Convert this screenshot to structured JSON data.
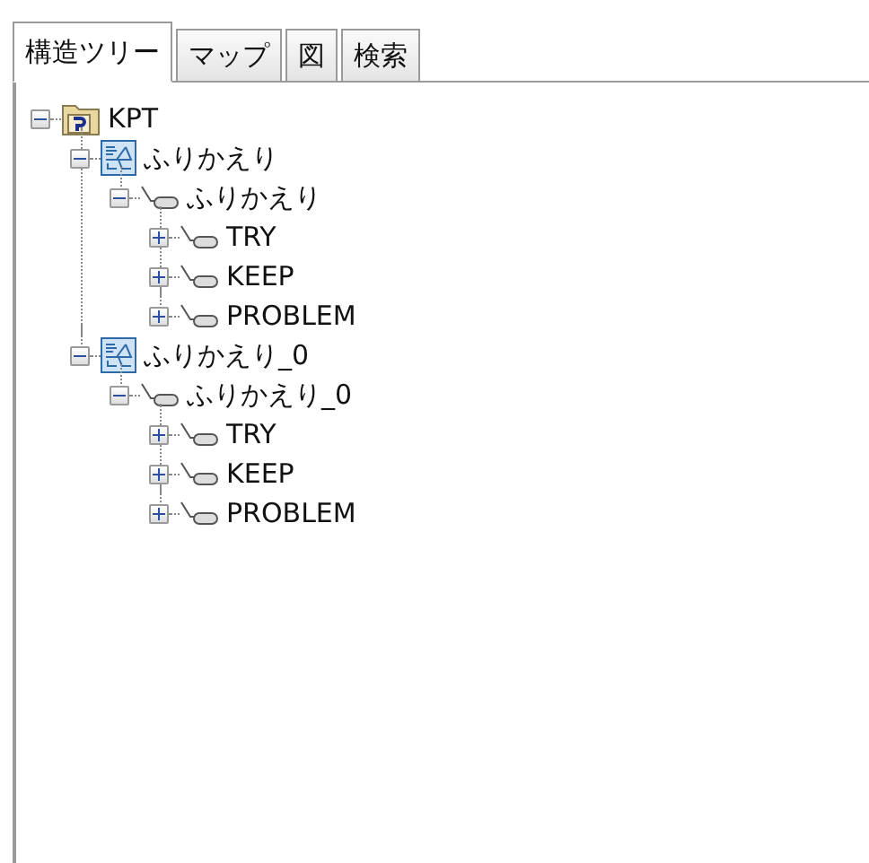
{
  "tabs": [
    {
      "label": "構造ツリー",
      "selected": true
    },
    {
      "label": "マップ",
      "selected": false
    },
    {
      "label": "図",
      "selected": false
    },
    {
      "label": "検索",
      "selected": false
    }
  ],
  "tree": [
    {
      "kind": "project",
      "label": "KPT",
      "expanded": true,
      "children": [
        {
          "kind": "map",
          "label": "ふりかえり",
          "expanded": true,
          "children": [
            {
              "kind": "topic",
              "label": "ふりかえり",
              "expanded": true,
              "children": [
                {
                  "kind": "topic",
                  "label": "TRY",
                  "expanded": false
                },
                {
                  "kind": "topic",
                  "label": "KEEP",
                  "expanded": false
                },
                {
                  "kind": "topic",
                  "label": "PROBLEM",
                  "expanded": false
                }
              ]
            }
          ]
        },
        {
          "kind": "map",
          "label": "ふりかえり_0",
          "expanded": true,
          "children": [
            {
              "kind": "topic",
              "label": "ふりかえり_0",
              "expanded": true,
              "children": [
                {
                  "kind": "topic",
                  "label": "TRY",
                  "expanded": false
                },
                {
                  "kind": "topic",
                  "label": "KEEP",
                  "expanded": false
                },
                {
                  "kind": "topic",
                  "label": "PROBLEM",
                  "expanded": false
                }
              ]
            }
          ]
        }
      ]
    }
  ]
}
